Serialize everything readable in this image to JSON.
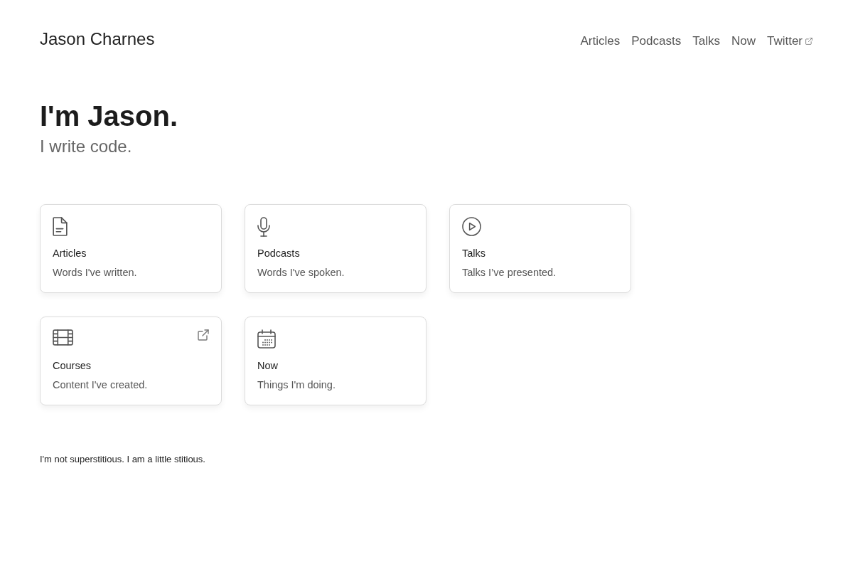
{
  "header": {
    "site_title": "Jason Charnes",
    "nav": [
      {
        "label": "Articles",
        "external": false
      },
      {
        "label": "Podcasts",
        "external": false
      },
      {
        "label": "Talks",
        "external": false
      },
      {
        "label": "Now",
        "external": false
      },
      {
        "label": "Twitter",
        "external": true
      }
    ]
  },
  "hero": {
    "title": "I'm Jason.",
    "subtitle": "I write code."
  },
  "cards": [
    {
      "title": "Articles",
      "description": "Words I've written.",
      "external": false
    },
    {
      "title": "Podcasts",
      "description": "Words I've spoken.",
      "external": false
    },
    {
      "title": "Talks",
      "description": "Talks I’ve presented.",
      "external": false
    },
    {
      "title": "Courses",
      "description": "Content I've created.",
      "external": true
    },
    {
      "title": "Now",
      "description": "Things I'm doing.",
      "external": false
    }
  ],
  "footer": {
    "text": "I'm not superstitious. I am a little stitious."
  }
}
